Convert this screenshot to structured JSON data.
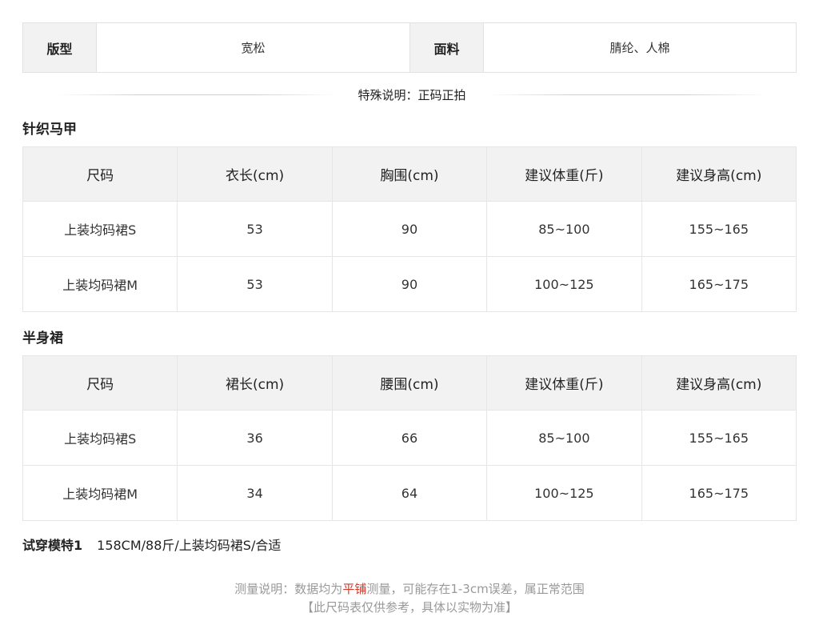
{
  "attributes": [
    {
      "key": "版型",
      "value": "宽松"
    },
    {
      "key": "面料",
      "value": "腈纶、人棉"
    }
  ],
  "special_note": "特殊说明：正码正拍",
  "vest": {
    "title": "针织马甲",
    "headers": [
      "尺码",
      "衣长(cm)",
      "胸围(cm)",
      "建议体重(斤)",
      "建议身高(cm)"
    ],
    "rows": [
      [
        "上装均码裙S",
        "53",
        "90",
        "85~100",
        "155~165"
      ],
      [
        "上装均码裙M",
        "53",
        "90",
        "100~125",
        "165~175"
      ]
    ]
  },
  "skirt": {
    "title": "半身裙",
    "headers": [
      "尺码",
      "裙长(cm)",
      "腰围(cm)",
      "建议体重(斤)",
      "建议身高(cm)"
    ],
    "rows": [
      [
        "上装均码裙S",
        "36",
        "66",
        "85~100",
        "155~165"
      ],
      [
        "上装均码裙M",
        "34",
        "64",
        "100~125",
        "165~175"
      ]
    ]
  },
  "model": {
    "label": "试穿模特1",
    "info": "158CM/88斤/上装均码裙S/合适"
  },
  "footer": {
    "measure_prefix": "测量说明：数据均为",
    "measure_highlight": "平铺",
    "measure_suffix": "测量，可能存在1-3cm误差，属正常范围",
    "disclaimer": "【此尺码表仅供参考，具体以实物为准】"
  },
  "colors": {
    "highlight": "#d23a2c",
    "header_bg": "#f2f2f2"
  }
}
